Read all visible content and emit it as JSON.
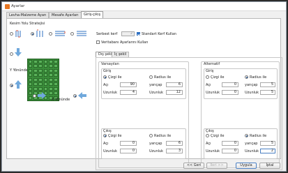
{
  "window": {
    "title": "Ayarlar"
  },
  "tabs": [
    {
      "label": "Levha-Malzeme Ayarı"
    },
    {
      "label": "Mesafe Ayarları"
    },
    {
      "label": "Giriş-çıkış"
    }
  ],
  "left": {
    "strategy_label": "Kesim Yolu Stratejisi",
    "y_direction_label": "Y Yönünde",
    "x_direction_label": "X Yönünde"
  },
  "top": {
    "kerf_label": "Serbest kerf",
    "kerf_value": "2",
    "standard_kerf_label": "Standart Kerf Kullan",
    "db_settings_label": "Veritabanı Ayarlarını Kullan"
  },
  "subtabs": [
    {
      "label": "Dış şekil"
    },
    {
      "label": "İç şekil"
    }
  ],
  "groups": {
    "default_title": "Varsayılan",
    "alt_title": "Alternatif"
  },
  "section": {
    "entry": "Giriş",
    "exit": "Çıkış",
    "line_with": "Çizgi ile",
    "radius_with": "Radius ile",
    "angle": "Açı",
    "length": "Uzunluk",
    "radius": "yarıçap"
  },
  "values": {
    "default_entry": {
      "angle": "90",
      "radius": "6",
      "length": "4",
      "length2": "12"
    },
    "default_exit": {
      "angle": "0",
      "radius": "6",
      "length": "0",
      "length2": "3"
    },
    "alt_entry": {
      "angle": "0",
      "radius": "5",
      "length": "0",
      "length2": "5"
    },
    "alt_exit": {
      "angle": "0",
      "radius": "5",
      "length": "0",
      "length2": "2"
    }
  },
  "footer": {
    "back": "<< Geri",
    "next": "İleri >>",
    "apply": "Uygula",
    "cancel": "İptal"
  }
}
